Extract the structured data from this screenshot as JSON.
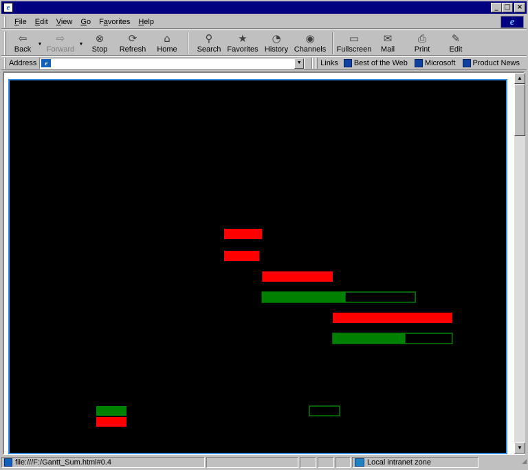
{
  "window": {
    "title": "",
    "controls": {
      "minimize": "_",
      "maximize": "□",
      "close": "×"
    }
  },
  "menu": {
    "items": [
      {
        "key": "F",
        "rest": "ile"
      },
      {
        "key": "E",
        "rest": "dit"
      },
      {
        "key": "V",
        "rest": "iew"
      },
      {
        "key": "G",
        "rest": "o"
      },
      {
        "prefix": "F",
        "key": "a",
        "rest": "vorites"
      },
      {
        "key": "H",
        "rest": "elp"
      }
    ],
    "logo_glyph": "e"
  },
  "toolbar": {
    "back": {
      "label": "Back",
      "icon": "⇦"
    },
    "forward": {
      "label": "Forward",
      "icon": "⇨"
    },
    "stop": {
      "label": "Stop",
      "icon": "⊗"
    },
    "refresh": {
      "label": "Refresh",
      "icon": "⟳"
    },
    "home": {
      "label": "Home",
      "icon": "⌂"
    },
    "search": {
      "label": "Search",
      "icon": "⚲"
    },
    "favorites": {
      "label": "Favorites",
      "icon": "★"
    },
    "history": {
      "label": "History",
      "icon": "◔"
    },
    "channels": {
      "label": "Channels",
      "icon": "◉"
    },
    "fullscreen": {
      "label": "Fullscreen",
      "icon": "▭"
    },
    "mail": {
      "label": "Mail",
      "icon": "✉"
    },
    "print": {
      "label": "Print",
      "icon": "⎙"
    },
    "edit": {
      "label": "Edit",
      "icon": "✎"
    },
    "dropdown_arrow": "▼"
  },
  "address": {
    "label": "Address",
    "value": "",
    "dropdown_arrow": "▼"
  },
  "links": {
    "label": "Links",
    "items": [
      "Best of the Web",
      "Microsoft",
      "Product News"
    ]
  },
  "scrollbar": {
    "up_arrow": "▲",
    "down_arrow": "▼"
  },
  "status": {
    "url": "file:///F:/Gantt_Sum.html#0.4",
    "zone": "Local intranet zone"
  },
  "colors": {
    "plan": "#ff0000",
    "actual": "#008000",
    "background": "#000000",
    "frame_border": "#3a8ee6"
  },
  "chart_data": {
    "type": "gantt",
    "tasks": [
      {
        "planned": [
          0.0,
          0.07
        ]
      },
      {
        "planned": [
          0.0,
          0.065
        ]
      },
      {
        "planned": [
          0.07,
          0.2
        ]
      },
      {
        "planned": [
          0.07,
          0.352
        ],
        "actual_progress": 0.545
      },
      {
        "planned": [
          0.2,
          0.42
        ]
      },
      {
        "planned": [
          0.2,
          0.42
        ],
        "actual_progress": 0.608
      }
    ],
    "legend": [
      {
        "series": "actual",
        "outline_marker": true
      },
      {
        "series": "plan"
      }
    ]
  }
}
